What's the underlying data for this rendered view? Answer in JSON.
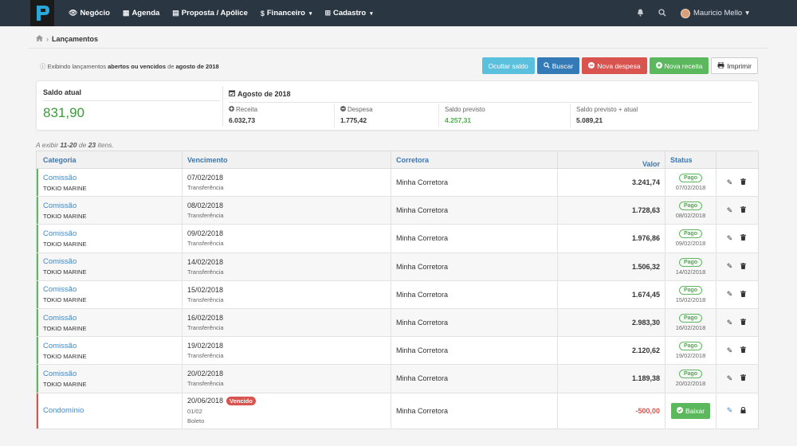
{
  "navbar": {
    "items": [
      {
        "icon": "eye-icon",
        "glyph": "👁",
        "label": "Negócio",
        "caret": ""
      },
      {
        "icon": "calendar-icon",
        "glyph": "▦",
        "label": "Agenda",
        "caret": ""
      },
      {
        "icon": "document-icon",
        "glyph": "▤",
        "label": "Proposta / Apólice",
        "caret": ""
      },
      {
        "icon": "dollar-icon",
        "glyph": "$",
        "label": "Financeiro",
        "caret": "▾"
      },
      {
        "icon": "plus-square-icon",
        "glyph": "⊞",
        "label": "Cadastro",
        "caret": "▾"
      }
    ],
    "user_name": "Mauricio Mello"
  },
  "breadcrumb": {
    "current": "Lançamentos"
  },
  "info": {
    "prefix": "Exibindo lançamentos ",
    "strong1": "abertos ou vencidos",
    "middle": " de ",
    "strong2": "agosto de 2018"
  },
  "actions": {
    "hide_balance": "Ocultar saldo",
    "search": "Buscar",
    "new_expense": "Nova despesa",
    "new_income": "Nova receita",
    "print": "Imprimir"
  },
  "summary": {
    "saldo_label": "Saldo atual",
    "saldo_value": "831,90",
    "month": "Agosto de 2018",
    "receita_label": "Receita",
    "receita_value": "6.032,73",
    "despesa_label": "Despesa",
    "despesa_value": "1.775,42",
    "previsto_label": "Saldo previsto",
    "previsto_value": "4.257,31",
    "previsto_atual_label": "Saldo previsto + atual",
    "previsto_atual_value": "5.089,21"
  },
  "count": {
    "prefix": "A exibir ",
    "range": "11-20",
    "middle": " de ",
    "total": "23",
    "suffix": " itens."
  },
  "table": {
    "headers": {
      "categoria": "Categoria",
      "vencimento": "Vencimento",
      "corretora": "Corretora",
      "valor": "Valor",
      "status": "Status"
    },
    "rows": [
      {
        "categoria": "Comissão",
        "seguradora": "TOKIO MARINE",
        "data": "07/02/2018",
        "forma": "Transferência",
        "corretora": "Minha Corretora",
        "valor": "3.241,74",
        "status": "Pago",
        "status_data": "07/02/2018"
      },
      {
        "categoria": "Comissão",
        "seguradora": "TOKIO MARINE",
        "data": "08/02/2018",
        "forma": "Transferência",
        "corretora": "Minha Corretora",
        "valor": "1.728,63",
        "status": "Pago",
        "status_data": "08/02/2018"
      },
      {
        "categoria": "Comissão",
        "seguradora": "TOKIO MARINE",
        "data": "09/02/2018",
        "forma": "Transferência",
        "corretora": "Minha Corretora",
        "valor": "1.976,86",
        "status": "Pago",
        "status_data": "09/02/2018"
      },
      {
        "categoria": "Comissão",
        "seguradora": "TOKIO MARINE",
        "data": "14/02/2018",
        "forma": "Transferência",
        "corretora": "Minha Corretora",
        "valor": "1.506,32",
        "status": "Pago",
        "status_data": "14/02/2018"
      },
      {
        "categoria": "Comissão",
        "seguradora": "TOKIO MARINE",
        "data": "15/02/2018",
        "forma": "Transferência",
        "corretora": "Minha Corretora",
        "valor": "1.674,45",
        "status": "Pago",
        "status_data": "15/02/2018"
      },
      {
        "categoria": "Comissão",
        "seguradora": "TOKIO MARINE",
        "data": "16/02/2018",
        "forma": "Transferência",
        "corretora": "Minha Corretora",
        "valor": "2.983,30",
        "status": "Pago",
        "status_data": "16/02/2018"
      },
      {
        "categoria": "Comissão",
        "seguradora": "TOKIO MARINE",
        "data": "19/02/2018",
        "forma": "Transferência",
        "corretora": "Minha Corretora",
        "valor": "2.120,62",
        "status": "Pago",
        "status_data": "19/02/2018"
      },
      {
        "categoria": "Comissão",
        "seguradora": "TOKIO MARINE",
        "data": "20/02/2018",
        "forma": "Transferência",
        "corretora": "Minha Corretora",
        "valor": "1.189,38",
        "status": "Pago",
        "status_data": "20/02/2018"
      }
    ],
    "last_row": {
      "categoria": "Condomínio",
      "data": "20/06/2018",
      "badge": "Vencido",
      "parcela": "01/02",
      "forma": "Boleto",
      "corretora": "Minha Corretora",
      "valor": "-500,00",
      "action": "Baixar"
    }
  }
}
